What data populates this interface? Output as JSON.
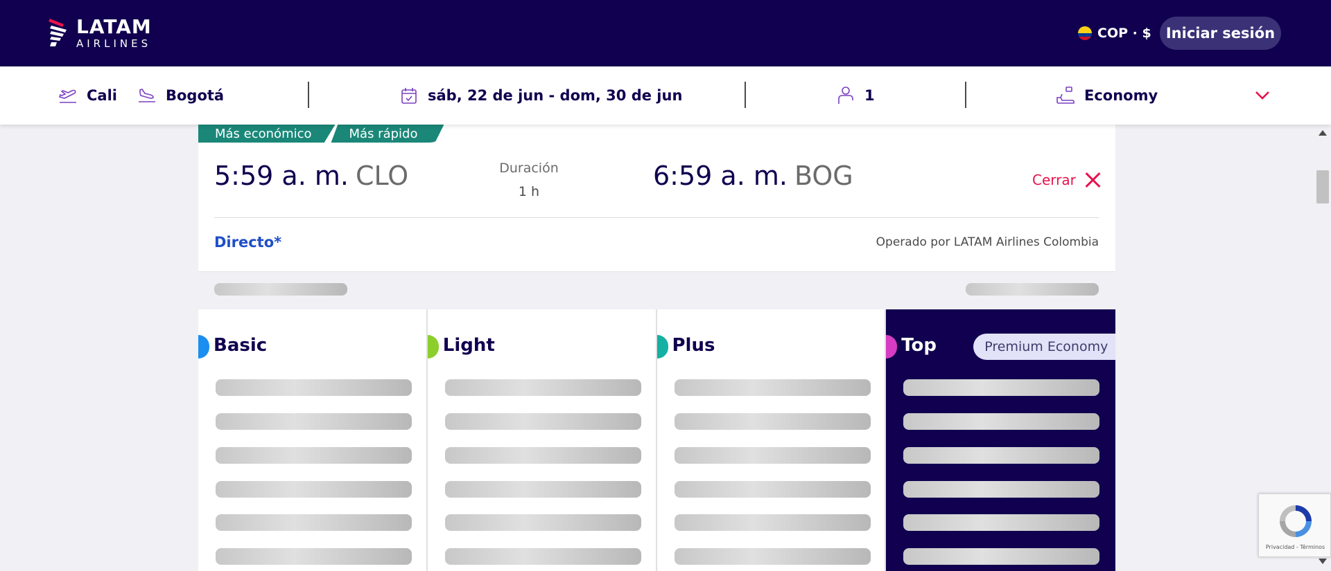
{
  "header": {
    "logo_line1": "LATAM",
    "logo_line2": "AIRLINES",
    "currency": "COP · $",
    "login_label": "Iniciar sesión"
  },
  "search": {
    "origin": "Cali",
    "destination": "Bogotá",
    "dates": "sáb, 22 de jun - dom, 30 de jun",
    "passengers": "1",
    "cabin": "Economy"
  },
  "flight": {
    "tags": [
      "Más económico",
      "Más rápido"
    ],
    "departure_time": "5:59 a. m.",
    "departure_code": "CLO",
    "duration_label": "Duración",
    "duration_value": "1 h",
    "arrival_time": "6:59 a. m.",
    "arrival_code": "BOG",
    "close_label": "Cerrar",
    "stops": "Directo*",
    "operated_by": "Operado por LATAM Airlines Colombia"
  },
  "fares": [
    {
      "name": "Basic",
      "color": "#1b8ef0"
    },
    {
      "name": "Light",
      "color": "#8ccf2d"
    },
    {
      "name": "Plus",
      "color": "#13b0a3"
    },
    {
      "name": "Top",
      "color": "#d63cc4",
      "badge": "Premium Economy"
    }
  ],
  "recaptcha": {
    "links": "Privacidad - Términos"
  },
  "colors": {
    "brand_dark": "#10004f",
    "accent_red": "#e8114b",
    "tag_green": "#1a8778",
    "link_blue": "#1f4ec7"
  }
}
